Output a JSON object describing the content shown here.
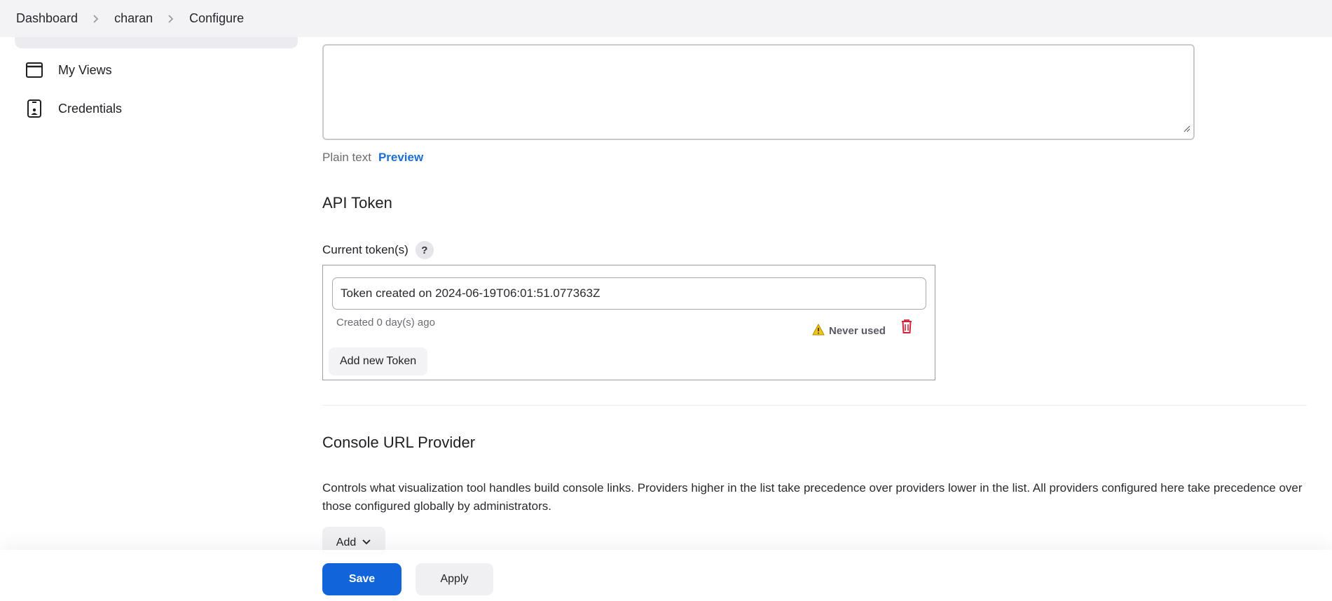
{
  "breadcrumb": {
    "items": [
      {
        "label": "Dashboard"
      },
      {
        "label": "charan"
      },
      {
        "label": "Configure"
      }
    ]
  },
  "sidebar": {
    "items": [
      {
        "label": "My Views",
        "icon": "window-icon"
      },
      {
        "label": "Credentials",
        "icon": "phone-badge-icon"
      }
    ]
  },
  "description": {
    "value": "",
    "format_plain": "Plain text",
    "format_preview": "Preview"
  },
  "api_token": {
    "heading": "API Token",
    "current_label": "Current token(s)",
    "help_label": "?",
    "token": {
      "name": "Token created on 2024-06-19T06:01:51.077363Z",
      "created": "Created 0 day(s) ago",
      "usage": "Never used"
    },
    "add_label": "Add new Token"
  },
  "console_url": {
    "heading": "Console URL Provider",
    "description": "Controls what visualization tool handles build console links. Providers higher in the list take precedence over providers lower in the list. All providers configured here take precedence over those configured globally by administrators.",
    "add_label": "Add"
  },
  "actions": {
    "save_label": "Save",
    "apply_label": "Apply"
  },
  "colors": {
    "primary": "#1164da",
    "link": "#1a6fd1",
    "danger": "#d3243a",
    "warning": "#f2c511"
  }
}
